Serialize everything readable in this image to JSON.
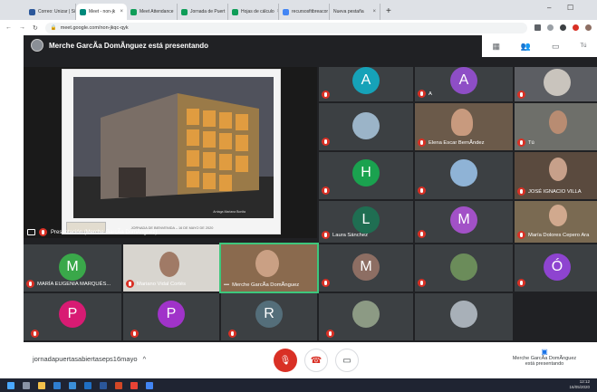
{
  "browser": {
    "tabs": [
      {
        "label": "Correo: Unizar | Si",
        "color": "#2b579a"
      },
      {
        "label": "Meet - non-jk",
        "color": "#00897b",
        "active": true
      },
      {
        "label": "Meet Attendance",
        "color": "#0f9d58"
      },
      {
        "label": "Jornada de Puert",
        "color": "#0f9d58"
      },
      {
        "label": "Hojas de cálculo",
        "color": "#0f9d58"
      },
      {
        "label": "recursosfitbreacor",
        "color": "#4285f4"
      },
      {
        "label": "Nueva pestaña",
        "color": "#dee1e6"
      }
    ],
    "new_tab": "+",
    "url": "meet.google.com/non-jkqc-qyk",
    "window_min": "–",
    "window_max": "☐"
  },
  "meet": {
    "presenting_banner": "Merche GarcÃa DomÃnguez está presentando",
    "top_right_you": "Tú",
    "presentation_label": "Presentación (Merche GarcÃa DomÃnguez)",
    "slide_footer": "JORNADA DE BIENVENIDA – 16 DE MAYO DE 2020",
    "photo_caption": "Arriaga Mariana Bonita"
  },
  "tiles": [
    {
      "id": "t1",
      "name": "",
      "initial": "A",
      "color": "#16a2b8"
    },
    {
      "id": "t2",
      "name": "A",
      "initial": "A",
      "color": "#8e4ec6"
    },
    {
      "id": "t3",
      "name": "",
      "initial": "",
      "color": ""
    },
    {
      "id": "t4",
      "name": "",
      "initial": "",
      "color": ""
    },
    {
      "id": "t5",
      "name": "Elena Escar BernÃndez",
      "initial": "",
      "color": ""
    },
    {
      "id": "t6",
      "name": "Tú",
      "initial": "",
      "color": ""
    },
    {
      "id": "t7",
      "name": "",
      "initial": "H",
      "color": "#1aa24f"
    },
    {
      "id": "t8",
      "name": "",
      "initial": "",
      "color": ""
    },
    {
      "id": "t9",
      "name": "JOSÉ IGNACIO VILLA",
      "initial": "",
      "color": ""
    },
    {
      "id": "t10",
      "name": "Laura Sánchez",
      "initial": "L",
      "color": "#1f6e52"
    },
    {
      "id": "t11",
      "name": "",
      "initial": "M",
      "color": "#a251c7"
    },
    {
      "id": "t12",
      "name": "María Dolores Cepero Ara",
      "initial": "",
      "color": ""
    },
    {
      "id": "t13",
      "name": "MARÍA EUGENIA MARQUÉS...",
      "initial": "M",
      "color": "#3aa84a"
    },
    {
      "id": "t14",
      "name": "Mariano Vidal Cortés",
      "initial": "",
      "color": ""
    },
    {
      "id": "t15",
      "name": "Merche GarcÃa DomÃnguez",
      "initial": "",
      "color": ""
    },
    {
      "id": "t16",
      "name": "",
      "initial": "M",
      "color": "#8d6e63"
    },
    {
      "id": "t17",
      "name": "",
      "initial": "",
      "color": ""
    },
    {
      "id": "t18",
      "name": "",
      "initial": "Ó",
      "color": "#8e44d0"
    },
    {
      "id": "t19",
      "name": "",
      "initial": "P",
      "color": "#d81b73"
    },
    {
      "id": "t20",
      "name": "",
      "initial": "P",
      "color": "#a033c9"
    },
    {
      "id": "t21",
      "name": "",
      "initial": "R",
      "color": "#546e7a"
    }
  ],
  "bottom": {
    "meeting_code": "jornadapuertasabiertaseps16mayo",
    "caret": "^",
    "presenting_info": "Merche GarcÃa DomÃnguez\nestá presentando"
  },
  "tray": {
    "time": "12:12",
    "date": "16/05/2020"
  }
}
